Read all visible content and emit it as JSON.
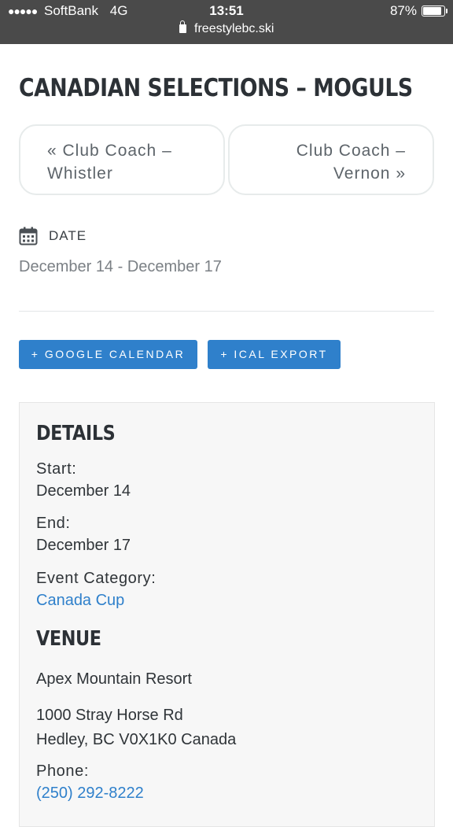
{
  "statusbar": {
    "carrier": "SoftBank",
    "network": "4G",
    "time": "13:51",
    "battery_percent": "87%",
    "battery_level": 0.87,
    "url": "freestylebc.ski"
  },
  "page": {
    "title": "CANADIAN SELECTIONS – MOGULS"
  },
  "nav": {
    "prev_line1": "« Club Coach –",
    "prev_line2": "Whistler",
    "next_line1": "Club Coach –",
    "next_line2": "Vernon »"
  },
  "date": {
    "label": "DATE",
    "value": "December 14 - December 17"
  },
  "buttons": {
    "google": "+ GOOGLE CALENDAR",
    "ical": "+ ICAL EXPORT"
  },
  "details": {
    "heading": "DETAILS",
    "start_label": "Start:",
    "start_value": "December 14",
    "end_label": "End:",
    "end_value": "December 17",
    "category_label": "Event Category:",
    "category_value": "Canada Cup"
  },
  "venue": {
    "heading": "VENUE",
    "name": "Apex Mountain Resort",
    "address_line1": "1000 Stray Horse Rd",
    "address_line2": "Hedley, BC V0X1K0 Canada",
    "phone_label": "Phone:",
    "phone_value": "(250) 292-8222"
  },
  "colors": {
    "accent": "#2f80cb",
    "status_bar": "#4a4a4a",
    "title": "#2c3136"
  }
}
